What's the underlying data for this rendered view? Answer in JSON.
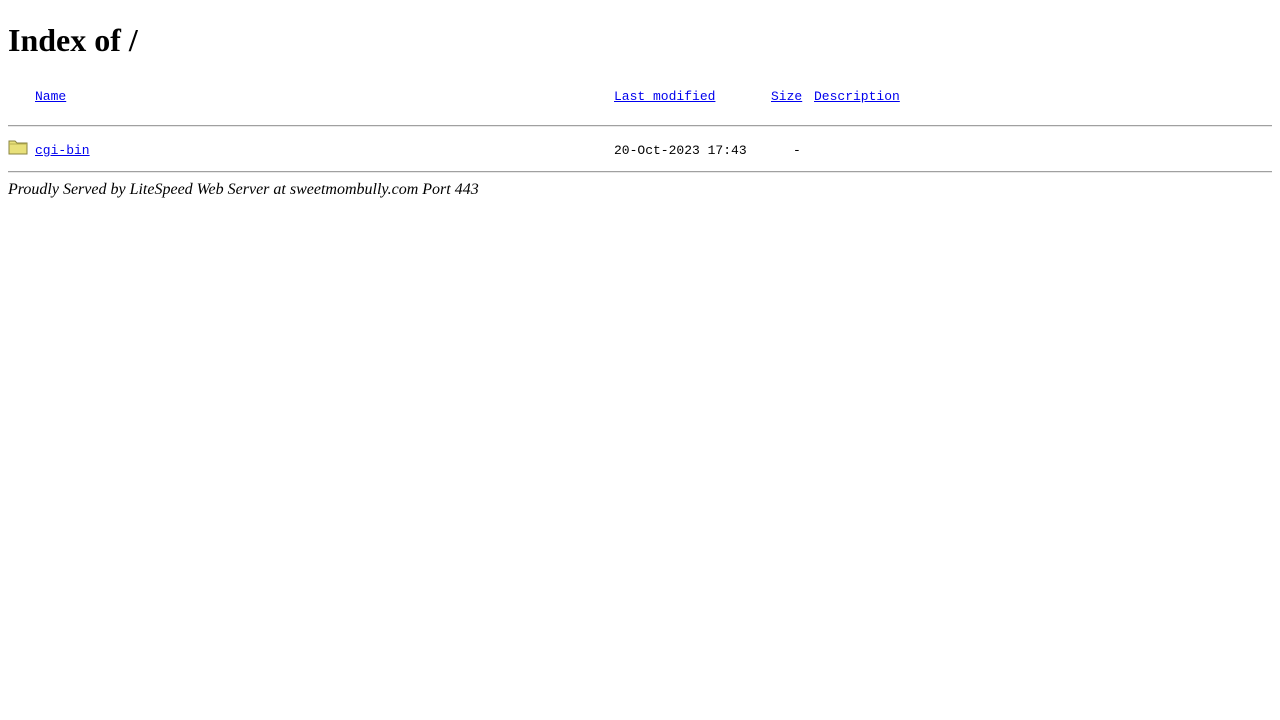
{
  "page": {
    "title": "Index of /"
  },
  "table": {
    "headers": {
      "name": "Name",
      "last_modified": "Last modified",
      "size": "Size",
      "description": "Description"
    },
    "rows": [
      {
        "icon": "folder-icon",
        "name": "cgi-bin",
        "last_modified": "20-Oct-2023 17:43",
        "size": "-",
        "description": ""
      }
    ]
  },
  "footer": {
    "text": "Proudly Served by LiteSpeed Web Server at sweetmombully.com Port 443"
  },
  "colors": {
    "link": "#0000ee",
    "folder_fill": "#e8e07a",
    "folder_stroke": "#8a8440"
  }
}
